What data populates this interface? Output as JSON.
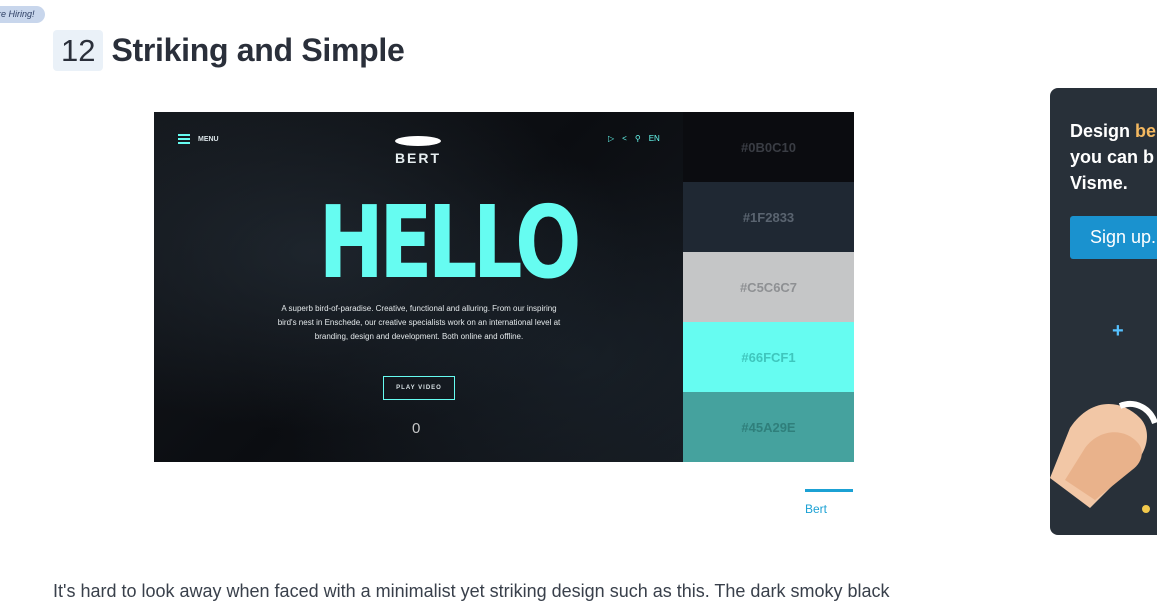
{
  "hiring_badge": "re Hiring!",
  "section": {
    "number": "12",
    "title": "Striking and Simple"
  },
  "mockup": {
    "menu_label": "MENU",
    "logo_text": "BERT",
    "lang_label": "EN",
    "hero_title": "HELLO",
    "description": "A superb bird-of-paradise. Creative, functional and alluring. From our inspiring bird's nest in Enschede, our creative specialists work on an international level at branding, design and development. Both online and offline.",
    "play_button": "PLAY VIDEO",
    "counter": "0",
    "accent_color": "#66fcf1"
  },
  "palette": [
    {
      "hex": "#0B0C10",
      "color": "#0b0c10",
      "text_color": "#3a3d44"
    },
    {
      "hex": "#1F2833",
      "color": "#1f2833",
      "text_color": "#5a6470"
    },
    {
      "hex": "#C5C6C7",
      "color": "#c5c6c7",
      "text_color": "#8e9093"
    },
    {
      "hex": "#66FCF1",
      "color": "#66fcf1",
      "text_color": "#3fc6bd"
    },
    {
      "hex": "#45A29E",
      "color": "#45a29e",
      "text_color": "#2f7f7b"
    }
  ],
  "caption": "Bert",
  "body_text": "It's hard to look away when faced with a minimalist yet striking design such as this. The dark smoky black",
  "promo": {
    "line1_pre": "Design ",
    "line1_hl": "be",
    "line2": "you can b",
    "line3": "Visme.",
    "button": "Sign up."
  }
}
